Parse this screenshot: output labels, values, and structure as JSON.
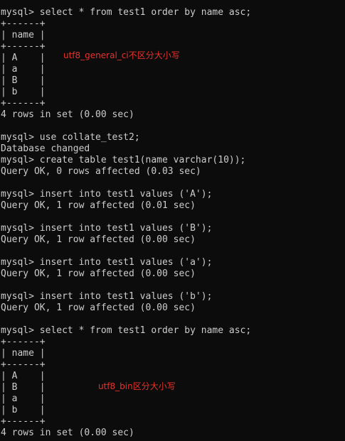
{
  "terminal": {
    "lines": [
      "mysql> select * from test1 order by name asc;",
      "+------+",
      "| name |",
      "+------+",
      "| A    |",
      "| a    |",
      "| B    |",
      "| b    |",
      "+------+",
      "4 rows in set (0.00 sec)",
      "",
      "mysql> use collate_test2;",
      "Database changed",
      "mysql> create table test1(name varchar(10));",
      "Query OK, 0 rows affected (0.03 sec)",
      "",
      "mysql> insert into test1 values ('A');",
      "Query OK, 1 row affected (0.01 sec)",
      "",
      "mysql> insert into test1 values ('B');",
      "Query OK, 1 row affected (0.00 sec)",
      "",
      "mysql> insert into test1 values ('a');",
      "Query OK, 1 row affected (0.00 sec)",
      "",
      "mysql> insert into test1 values ('b');",
      "Query OK, 1 row affected (0.00 sec)",
      "",
      "mysql> select * from test1 order by name asc;",
      "+------+",
      "| name |",
      "+------+",
      "| A    |",
      "| B    |",
      "| a    |",
      "| b    |",
      "+------+",
      "4 rows in set (0.00 sec)"
    ]
  },
  "annotations": {
    "general_ci": "utf8_general_ci不区分大小写",
    "bin": "utf8_bin区分大小写"
  },
  "colors": {
    "background": "#0c0c0c",
    "text": "#cccccc",
    "annotation": "#e8322b"
  }
}
